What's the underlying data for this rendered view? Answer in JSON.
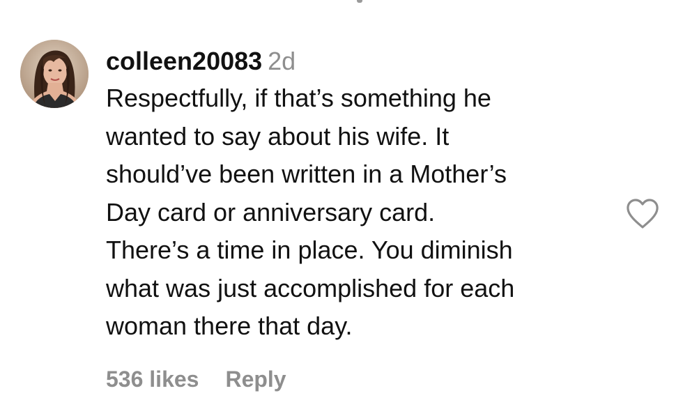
{
  "comment": {
    "username": "colleen20083",
    "time_ago": "2d",
    "text": "Respectfully, if that’s something he\nwanted to say about his wife. It\nshould’ve been written in a Mother’s\nDay card or anniversary card.\nThere’s a time in place. You diminish\nwhat was just accomplished for each\nwoman there that day.",
    "likes_label": "536 likes",
    "reply_label": "Reply",
    "like_icon": "heart-outline-icon"
  },
  "colors": {
    "text": "#111111",
    "muted": "#8e8e8e",
    "background": "#ffffff"
  }
}
